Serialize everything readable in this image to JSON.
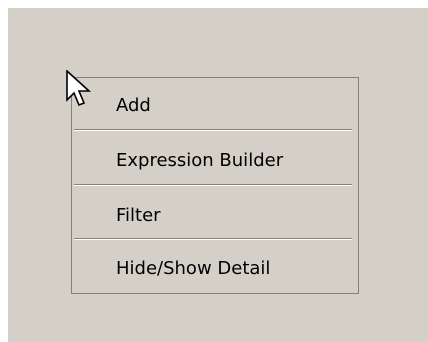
{
  "context_menu": {
    "items": [
      {
        "label": "Add"
      },
      {
        "label": "Expression Builder"
      },
      {
        "label": "Filter"
      },
      {
        "label": "Hide/Show Detail"
      }
    ]
  },
  "cursor": {
    "icon": "arrow-pointer-icon"
  },
  "colors": {
    "background": "#d4d0c8",
    "border": "#808080",
    "text": "#000000"
  }
}
